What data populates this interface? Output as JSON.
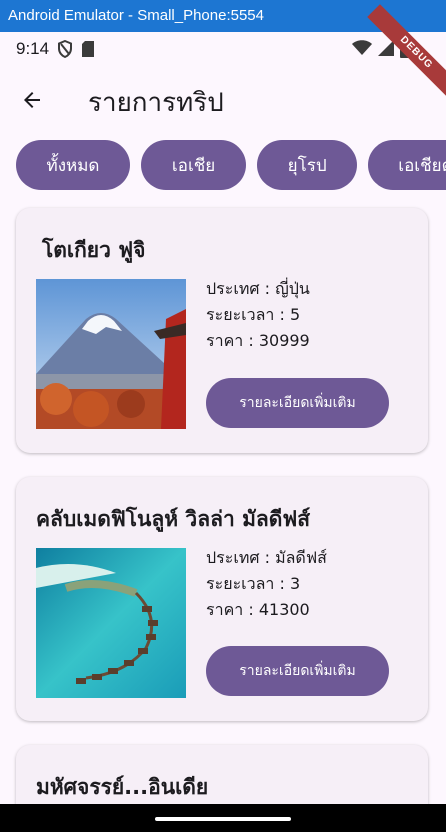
{
  "window": {
    "title": "Android Emulator - Small_Phone:5554"
  },
  "status": {
    "time": "9:14",
    "debug_label": "DEBUG"
  },
  "appbar": {
    "title": "รายการทริป",
    "back_icon": "arrow-back-icon"
  },
  "filters": [
    "ทั้งหมด",
    "เอเชีย",
    "ยุโรป",
    "เอเชียตะวันออกเฉียงใต้"
  ],
  "trips": [
    {
      "title": "โตเกียว ฟูจิ",
      "country": "ประเทศ : ญี่ปุ่น",
      "duration": "ระยะเวลา : 5",
      "price": "ราคา : 30999",
      "button": "รายละเอียดเพิ่มเติม"
    },
    {
      "title": "คลับเมดฟิโนลูห์ วิลล่า มัลดีฟส์",
      "country": "ประเทศ : มัลดีฟส์",
      "duration": "ระยะเวลา : 3",
      "price": "ราคา : 41300",
      "button": "รายละเอียดเพิ่มเติม"
    },
    {
      "title": "มหัศจรรย์...อินเดีย"
    }
  ],
  "colors": {
    "accent": "#6e5996",
    "background": "#fdf7fe",
    "card": "#f6eff7",
    "titlebar": "#1d76d2"
  }
}
